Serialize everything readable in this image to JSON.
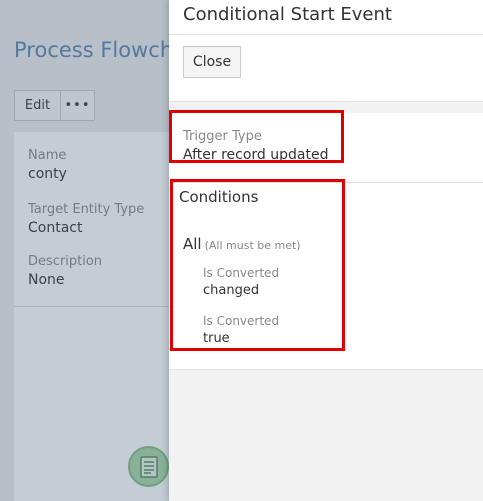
{
  "background_page": {
    "title": "Process Flowch",
    "toolbar": {
      "edit_label": "Edit",
      "more_label": "•••"
    },
    "fields": [
      {
        "label": "Name",
        "value": "conty"
      },
      {
        "label": "Target Entity Type",
        "value": "Contact"
      },
      {
        "label": "Description",
        "value": "None"
      }
    ],
    "flow_node_icon": "document-icon"
  },
  "side_panel": {
    "title": "Conditional Start Event",
    "close_label": "Close",
    "trigger": {
      "label": "Trigger Type",
      "value": "After record updated"
    },
    "conditions": {
      "title": "Conditions",
      "group_label": "All",
      "group_note": "(All must be met)",
      "items": [
        {
          "label": "Is Converted",
          "value": "changed"
        },
        {
          "label": "Is Converted",
          "value": "true"
        }
      ]
    }
  },
  "colors": {
    "highlight": "#e00000",
    "link_title": "#5b84b0",
    "overlay": "#465f7d"
  }
}
